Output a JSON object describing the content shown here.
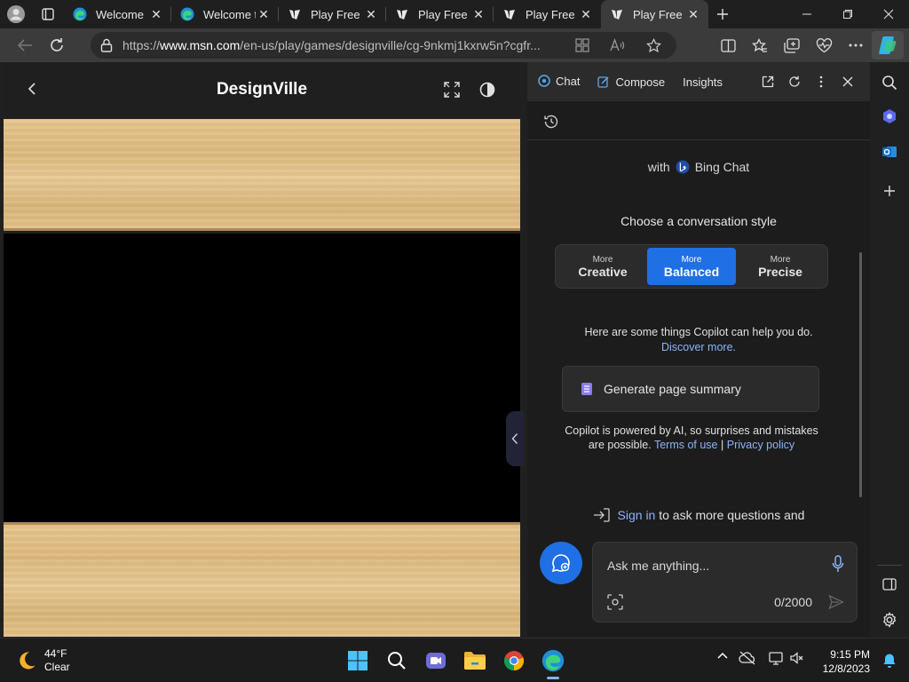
{
  "browser": {
    "tabs": [
      {
        "title": "Welcome",
        "favicon": "edge-icon",
        "active": false
      },
      {
        "title": "Welcome t",
        "favicon": "edge-icon",
        "active": false
      },
      {
        "title": "Play Free (",
        "favicon": "msn-games-icon",
        "active": false
      },
      {
        "title": "Play Free (",
        "favicon": "msn-games-icon",
        "active": false
      },
      {
        "title": "Play Free (",
        "favicon": "msn-games-icon",
        "active": false
      },
      {
        "title": "Play Free (",
        "favicon": "msn-games-icon",
        "active": true
      }
    ],
    "url_prefix": "https://",
    "url_host": "www.msn.com",
    "url_path": "/en-us/play/games/designville/cg-9nkmj1kxrw5n?cgfr..."
  },
  "game": {
    "title": "DesignVille"
  },
  "copilot": {
    "tabs": {
      "chat": "Chat",
      "compose": "Compose",
      "insights": "Insights"
    },
    "with_prefix": "with",
    "bing_chat": "Bing Chat",
    "style_title": "Choose a conversation style",
    "styles": [
      {
        "small": "More",
        "big": "Creative",
        "selected": false
      },
      {
        "small": "More",
        "big": "Balanced",
        "selected": true
      },
      {
        "small": "More",
        "big": "Precise",
        "selected": false
      }
    ],
    "help_line": "Here are some things Copilot can help you do.",
    "discover_more": "Discover more.",
    "summary_button": "Generate page summary",
    "disclaimer_line1": "Copilot is powered by AI, so surprises and mistakes",
    "disclaimer_line2": "are possible.",
    "terms": "Terms of use",
    "separator": "|",
    "privacy": "Privacy policy",
    "sign_in": "Sign in",
    "sign_in_suffix": "to ask more questions and",
    "input_placeholder": "Ask me anything...",
    "char_counter": "0/2000",
    "accent": "#1f6fe5"
  },
  "taskbar": {
    "temperature": "44°F",
    "condition": "Clear",
    "time": "9:15 PM",
    "date": "12/8/2023"
  }
}
